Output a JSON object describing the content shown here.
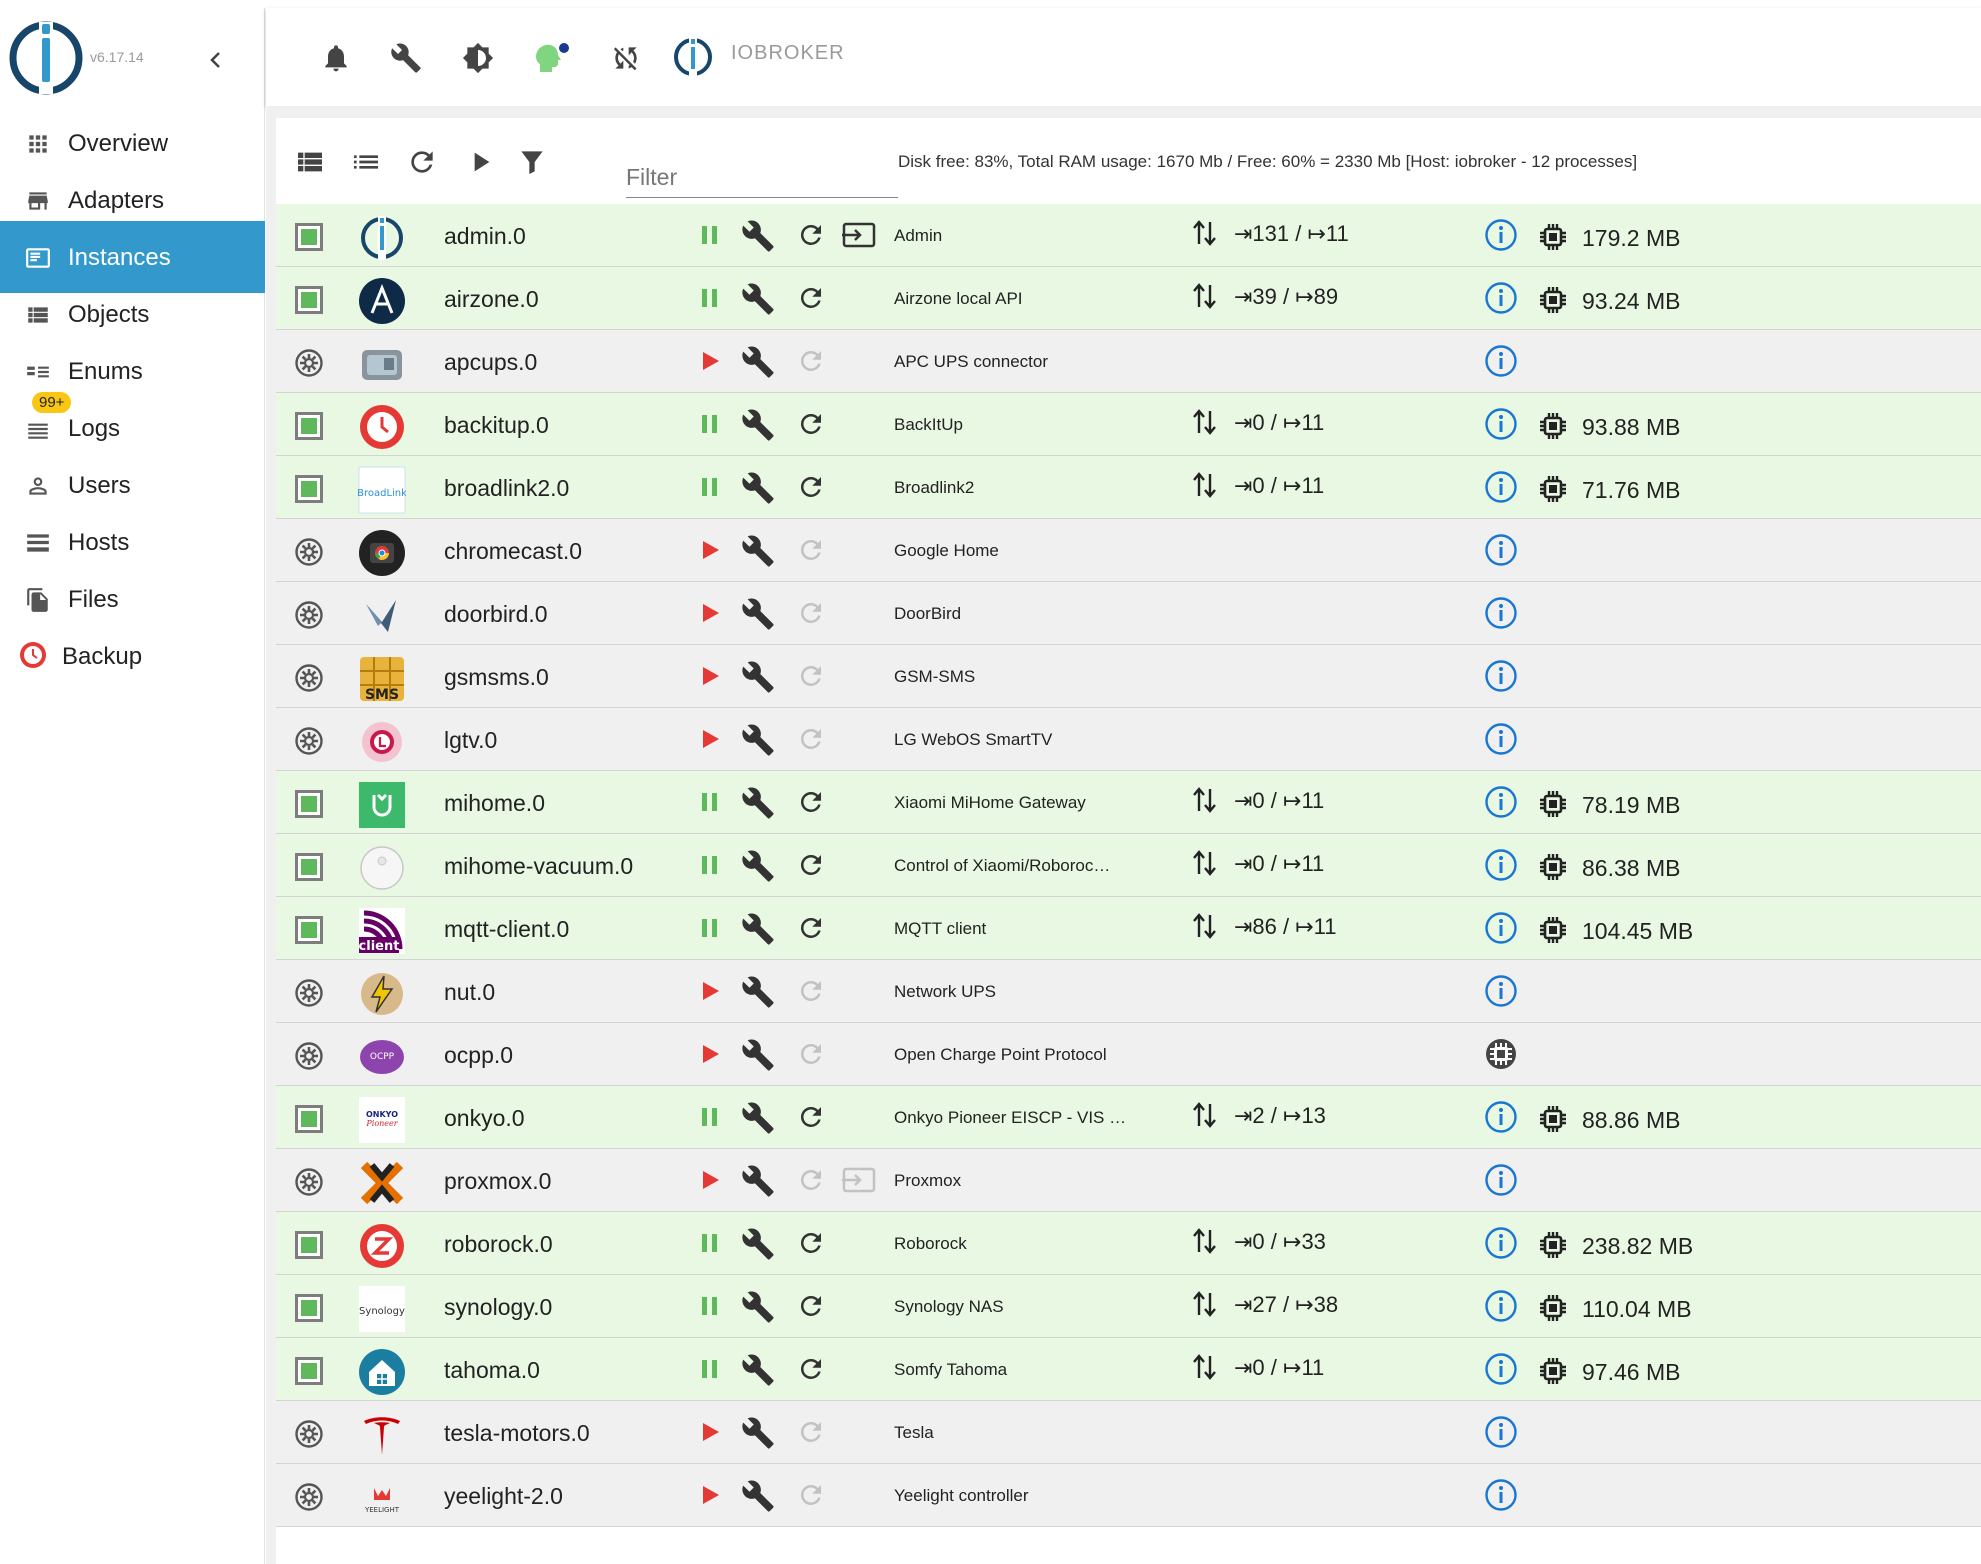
{
  "app": {
    "version": "v6.17.14",
    "title": "IOBROKER"
  },
  "sidebar": {
    "items": [
      {
        "label": "Overview",
        "icon": "overview-grid-icon"
      },
      {
        "label": "Adapters",
        "icon": "store-icon"
      },
      {
        "label": "Instances",
        "icon": "instances-icon",
        "active": true
      },
      {
        "label": "Objects",
        "icon": "list-icon"
      },
      {
        "label": "Enums",
        "icon": "enum-list-icon"
      },
      {
        "label": "Logs",
        "icon": "logs-icon",
        "badge": "99+"
      },
      {
        "label": "Users",
        "icon": "user-icon"
      },
      {
        "label": "Hosts",
        "icon": "storage-icon"
      },
      {
        "label": "Files",
        "icon": "files-icon"
      },
      {
        "label": "Backup",
        "icon": "backup-icon"
      }
    ]
  },
  "toolbar": {
    "filter_placeholder": "Filter",
    "host_info": "Disk free: 83%, Total RAM usage: 1670 Mb / Free: 60% = 2330 Mb [Host: iobroker - 12 processes]"
  },
  "instances": [
    {
      "name": "admin.0",
      "title": "Admin",
      "status": "running",
      "events": "⇥131 / ↦11",
      "memory": "179.2 MB",
      "link": true,
      "logo": "admin"
    },
    {
      "name": "airzone.0",
      "title": "Airzone local API",
      "status": "running",
      "events": "⇥39 / ↦89",
      "memory": "93.24 MB",
      "logo": "airzone"
    },
    {
      "name": "apcups.0",
      "title": "APC UPS connector",
      "status": "stopped",
      "events": "",
      "memory": "",
      "logo": "apcups"
    },
    {
      "name": "backitup.0",
      "title": "BackItUp",
      "status": "running",
      "events": "⇥0 / ↦11",
      "memory": "93.88 MB",
      "logo": "backitup"
    },
    {
      "name": "broadlink2.0",
      "title": "Broadlink2",
      "status": "running",
      "events": "⇥0 / ↦11",
      "memory": "71.76 MB",
      "logo": "broadlink"
    },
    {
      "name": "chromecast.0",
      "title": "Google Home",
      "status": "stopped",
      "events": "",
      "memory": "",
      "logo": "chromecast"
    },
    {
      "name": "doorbird.0",
      "title": "DoorBird",
      "status": "stopped",
      "events": "",
      "memory": "",
      "logo": "doorbird"
    },
    {
      "name": "gsmsms.0",
      "title": "GSM-SMS",
      "status": "stopped",
      "events": "",
      "memory": "",
      "logo": "gsmsms"
    },
    {
      "name": "lgtv.0",
      "title": "LG WebOS SmartTV",
      "status": "stopped",
      "events": "",
      "memory": "",
      "logo": "lgtv"
    },
    {
      "name": "mihome.0",
      "title": "Xiaomi MiHome Gateway",
      "status": "running",
      "events": "⇥0 / ↦11",
      "memory": "78.19 MB",
      "logo": "mihome"
    },
    {
      "name": "mihome-vacuum.0",
      "title": "Control of Xiaomi/Roboroc…",
      "status": "running",
      "events": "⇥0 / ↦11",
      "memory": "86.38 MB",
      "logo": "vacuum"
    },
    {
      "name": "mqtt-client.0",
      "title": "MQTT client",
      "status": "running",
      "events": "⇥86 / ↦11",
      "memory": "104.45 MB",
      "logo": "mqtt"
    },
    {
      "name": "nut.0",
      "title": "Network UPS",
      "status": "stopped",
      "events": "",
      "memory": "",
      "logo": "nut"
    },
    {
      "name": "ocpp.0",
      "title": "Open Charge Point Protocol",
      "status": "stopped",
      "events": "",
      "memory": "",
      "logo": "ocpp",
      "info_alt": true
    },
    {
      "name": "onkyo.0",
      "title": "Onkyo Pioneer EISCP - VIS …",
      "status": "running",
      "events": "⇥2 / ↦13",
      "memory": "88.86 MB",
      "logo": "onkyo"
    },
    {
      "name": "proxmox.0",
      "title": "Proxmox",
      "status": "stopped",
      "events": "",
      "memory": "",
      "link": true,
      "link_disabled": true,
      "logo": "proxmox"
    },
    {
      "name": "roborock.0",
      "title": "Roborock",
      "status": "running",
      "events": "⇥0 / ↦33",
      "memory": "238.82 MB",
      "logo": "roborock"
    },
    {
      "name": "synology.0",
      "title": "Synology NAS",
      "status": "running",
      "events": "⇥27 / ↦38",
      "memory": "110.04 MB",
      "logo": "synology"
    },
    {
      "name": "tahoma.0",
      "title": "Somfy Tahoma",
      "status": "running",
      "events": "⇥0 / ↦11",
      "memory": "97.46 MB",
      "logo": "tahoma"
    },
    {
      "name": "tesla-motors.0",
      "title": "Tesla",
      "status": "stopped",
      "events": "",
      "memory": "",
      "logo": "tesla"
    },
    {
      "name": "yeelight-2.0",
      "title": "Yeelight controller",
      "status": "stopped",
      "events": "",
      "memory": "",
      "logo": "yeelight"
    }
  ],
  "logo_texts": {
    "broadlink": "BroadLink",
    "gsmsms": "SMS",
    "mqtt": "client",
    "ocpp": "OCPP",
    "onkyo": "ONKYO",
    "onkyo2": "Pioneer",
    "synology": "Synology",
    "yeelight": "YEELIGHT"
  },
  "colors": {
    "accent": "#3399cc",
    "running_row": "#e9f8e3",
    "stopped_row": "#f0f0f0",
    "play_red": "#e53935",
    "pause_green": "#5fb85b",
    "info_blue": "#1976d2",
    "badge_yellow": "#f9c713"
  }
}
